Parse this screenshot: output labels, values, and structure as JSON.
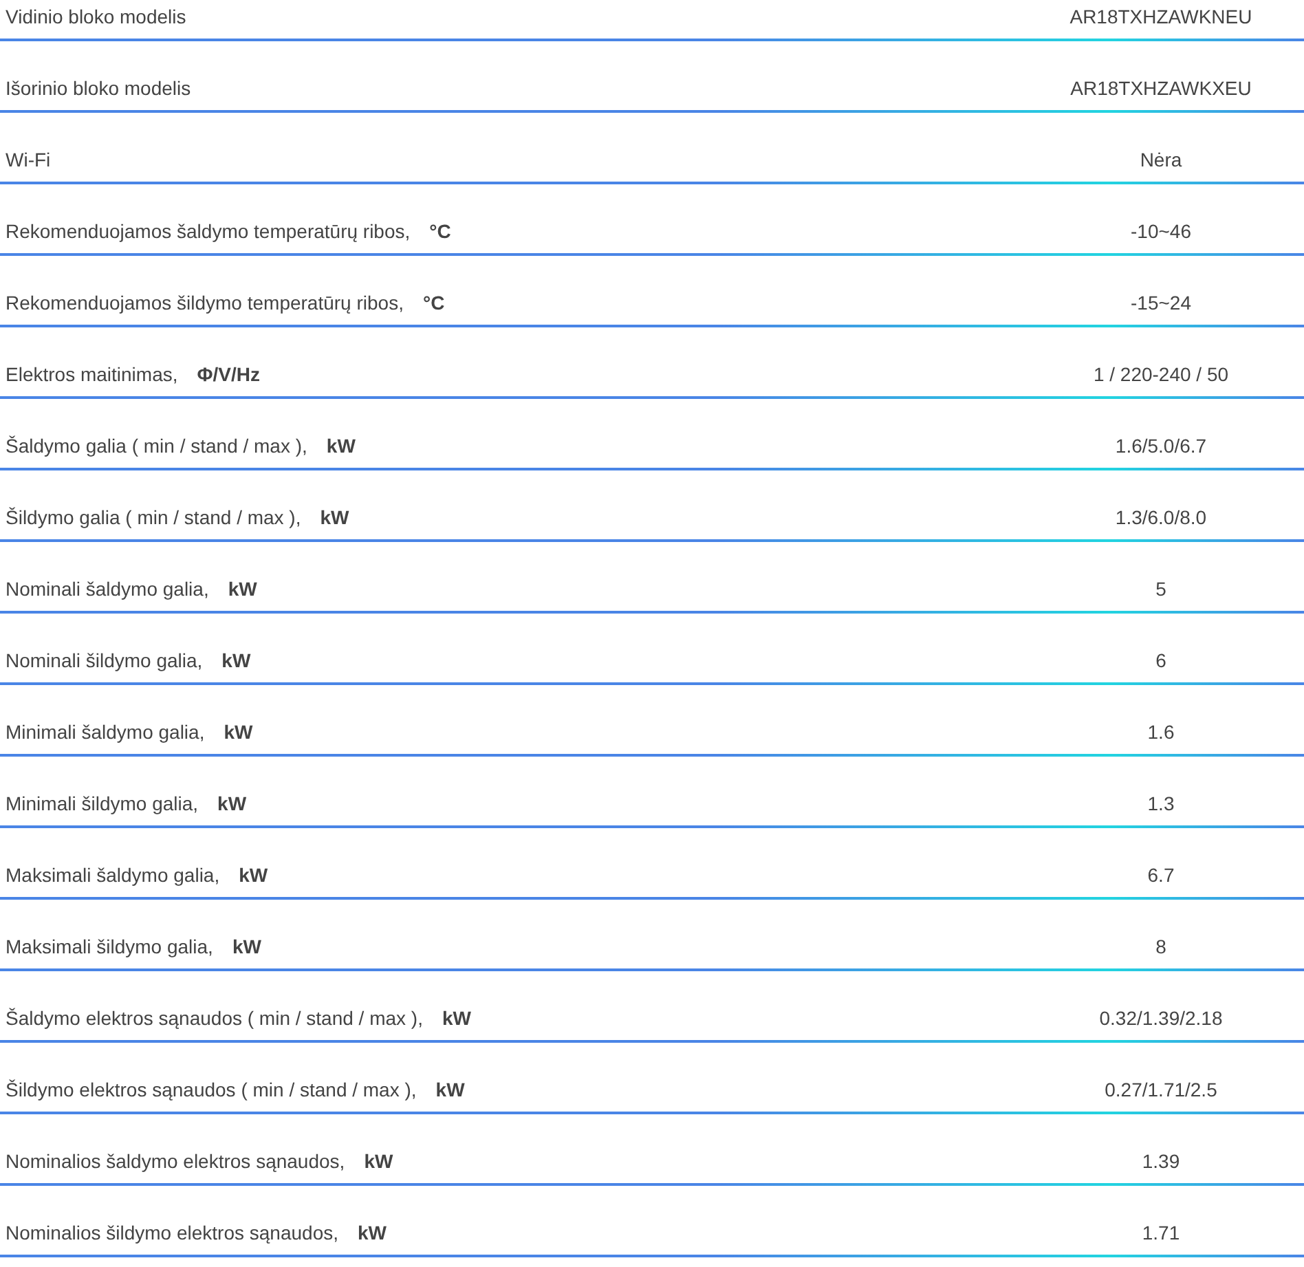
{
  "specs": [
    {
      "label": "Vidinio bloko modelis",
      "value": "AR18TXHZAWKNEU"
    },
    {
      "label": "Išorinio bloko modelis",
      "value": "AR18TXHZAWKXEU"
    },
    {
      "label": "Wi-Fi",
      "value": "Nėra"
    },
    {
      "label": "Rekomenduojamos šaldymo temperatūrų ribos,",
      "unit": "°C",
      "value": "-10~46"
    },
    {
      "label": "Rekomenduojamos šildymo temperatūrų ribos,",
      "unit": "°C",
      "value": "-15~24"
    },
    {
      "label": "Elektros maitinimas,",
      "unit": "Φ/V/Hz",
      "value": "1 / 220-240 / 50"
    },
    {
      "label": "Šaldymo galia ( min / stand / max ),",
      "unit": "kW",
      "value": "1.6/5.0/6.7"
    },
    {
      "label": "Šildymo galia ( min / stand / max ),",
      "unit": "kW",
      "value": "1.3/6.0/8.0"
    },
    {
      "label": "Nominali šaldymo galia,",
      "unit": "kW",
      "value": "5"
    },
    {
      "label": "Nominali šildymo galia,",
      "unit": "kW",
      "value": "6"
    },
    {
      "label": "Minimali šaldymo galia,",
      "unit": "kW",
      "value": "1.6"
    },
    {
      "label": "Minimali šildymo galia,",
      "unit": "kW",
      "value": "1.3"
    },
    {
      "label": "Maksimali šaldymo galia,",
      "unit": "kW",
      "value": "6.7"
    },
    {
      "label": "Maksimali šildymo galia,",
      "unit": "kW",
      "value": "8"
    },
    {
      "label": "Šaldymo elektros sąnaudos ( min / stand / max ),",
      "unit": "kW",
      "value": "0.32/1.39/2.18"
    },
    {
      "label": "Šildymo elektros sąnaudos ( min / stand / max ),",
      "unit": "kW",
      "value": "0.27/1.71/2.5"
    },
    {
      "label": "Nominalios šaldymo elektros sąnaudos,",
      "unit": "kW",
      "value": "1.39"
    },
    {
      "label": "Nominalios šildymo elektros sąnaudos,",
      "unit": "kW",
      "value": "1.71"
    }
  ]
}
